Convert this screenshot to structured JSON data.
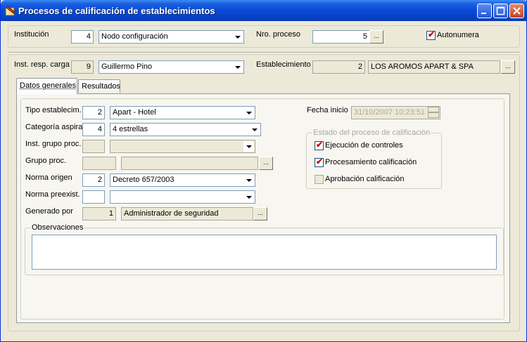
{
  "window": {
    "title": "Procesos de calificación de establecimientos"
  },
  "header": {
    "institucion_label": "Institución",
    "institucion_code": "4",
    "institucion_value": "Nodo configuración",
    "nro_proceso_label": "Nro. proceso",
    "nro_proceso_value": "5",
    "autonumera_label": "Autonumera",
    "lookup_button": "..."
  },
  "carga": {
    "inst_resp_label": "Inst. resp. carga",
    "inst_resp_code": "9",
    "inst_resp_value": "Guillermo Pino",
    "establecimiento_label": "Establecimiento",
    "establecimiento_code": "2",
    "establecimiento_value": "LOS AROMOS APART & SPA"
  },
  "tabs": [
    {
      "label": "Datos generales"
    },
    {
      "label": "Resultados"
    }
  ],
  "form": {
    "tipo_label": "Tipo establecim.",
    "tipo_code": "2",
    "tipo_value": "Apart - Hotel",
    "categoria_label": "Categoría aspira",
    "categoria_code": "4",
    "categoria_value": "4 estrellas",
    "inst_grupo_label": "Inst. grupo proc.",
    "grupo_label": "Grupo proc.",
    "norma_origen_label": "Norma origen",
    "norma_origen_code": "2",
    "norma_origen_value": "Decreto 657/2003",
    "norma_preexist_label": "Norma preexist.",
    "generado_label": "Generado por",
    "generado_code": "1",
    "generado_value": "Administrador de seguridad",
    "observaciones_label": "Observaciones",
    "fecha_inicio_label": "Fecha inicio",
    "fecha_inicio_value": "31/10/2007 10:23:51",
    "estado_label": "Estado del proceso de calificación",
    "ejecucion_label": "Ejecución de controles",
    "procesamiento_label": "Procesamiento calificación",
    "aprobacion_label": "Aprobación calificación"
  },
  "colors": {
    "titlebar": "#0a4ad4",
    "face": "#ece9d8",
    "check_red": "#cc0000"
  },
  "icons": [
    "app-icon",
    "minimize-icon",
    "maximize-icon",
    "close-icon",
    "dropdown-arrow-icon",
    "spin-up-icon",
    "spin-down-icon"
  ]
}
